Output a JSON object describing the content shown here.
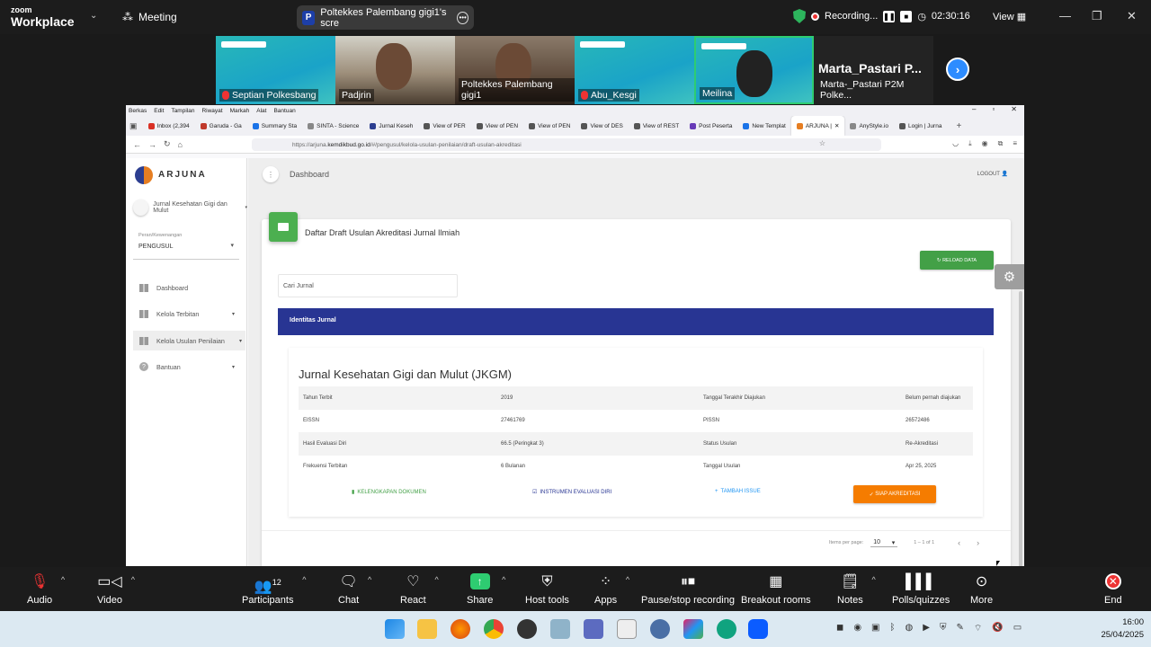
{
  "zoom": {
    "brand_small": "zoom",
    "brand": "Workplace",
    "meeting": "Meeting",
    "share_initial": "P",
    "share_title": "Poltekkes Palembang gigi1's scre",
    "recording": "Recording...",
    "timer": "02:30:16",
    "view": "View",
    "participants": [
      {
        "name": "Septian Polkesbang",
        "muted": true
      },
      {
        "name": "Padjrin",
        "muted": false
      },
      {
        "name": "Poltekkes Palembang gigi1",
        "muted": false
      },
      {
        "name": "Abu_Kesgi",
        "muted": true
      },
      {
        "name": "Meilina",
        "muted": false
      },
      {
        "name": "Marta-_Pastari P2M Polke...",
        "big": "Marta_Pastari P..."
      }
    ],
    "toolbar": {
      "audio": "Audio",
      "video": "Video",
      "participants": "Participants",
      "participants_count": "12",
      "chat": "Chat",
      "react": "React",
      "share": "Share",
      "host_tools": "Host tools",
      "apps": "Apps",
      "pause_rec": "Pause/stop recording",
      "breakout": "Breakout rooms",
      "notes": "Notes",
      "polls": "Polls/quizzes",
      "more": "More",
      "end": "End"
    }
  },
  "browser": {
    "menu": [
      "Berkas",
      "Edit",
      "Tampilan",
      "Riwayat",
      "Markah",
      "Alat",
      "Bantuan"
    ],
    "tabs": [
      {
        "label": "Inbox (2,394",
        "color": "#d93025"
      },
      {
        "label": "Garuda - Ga",
        "color": "#c0392b"
      },
      {
        "label": "Summary Sta",
        "color": "#1a73e8"
      },
      {
        "label": "SINTA - Science",
        "color": "#888"
      },
      {
        "label": "Jurnal Keseh",
        "color": "#2c3e90"
      },
      {
        "label": "View of PER",
        "color": "#555"
      },
      {
        "label": "View of PEN",
        "color": "#555"
      },
      {
        "label": "View of PEN",
        "color": "#555"
      },
      {
        "label": "View of DES",
        "color": "#555"
      },
      {
        "label": "View of REST",
        "color": "#555"
      },
      {
        "label": "Post Peserta",
        "color": "#673ab7"
      },
      {
        "label": "New Templat",
        "color": "#1a73e8"
      },
      {
        "label": "ARJUNA |",
        "color": "#e67e22",
        "active": true
      },
      {
        "label": "AnyStyle.io",
        "color": "#888"
      },
      {
        "label": "Login | Jurna",
        "color": "#555"
      }
    ],
    "url_prefix": "https://arjuna.",
    "url_domain": "kemdikbud.go.id",
    "url_path": "/#/pengusul/kelola-usulan-penilaian/draft-usulan-akreditasi"
  },
  "app": {
    "logo": "ARJUNA",
    "journal": "Jurnal Kesehatan Gigi dan Mulut",
    "role_label": "Peran/Kewenangan",
    "role_value": "PENGUSUL",
    "nav": [
      {
        "label": "Dashboard",
        "caret": ""
      },
      {
        "label": "Kelola Terbitan",
        "caret": "▾"
      },
      {
        "label": "Kelola Usulan Penilaian",
        "caret": "▾"
      },
      {
        "label": "Bantuan",
        "caret": "▾"
      }
    ],
    "breadcrumb": "Dashboard",
    "logout": "LOGOUT",
    "card_title": "Daftar Draft Usulan Akreditasi Jurnal Ilmiah",
    "reload": "RELOAD DATA",
    "search_placeholder": "Cari Jurnal",
    "section": "Identitas Jurnal",
    "journal_title": "Jurnal Kesehatan Gigi dan Mulut (JKGM)",
    "rows": [
      [
        "Tahun Terbit",
        "2019",
        "Tanggal Terakhir Diajukan",
        "Belum pernah diajukan"
      ],
      [
        "EISSN",
        "27461769",
        "PISSN",
        "26572486"
      ],
      [
        "Hasil Evaluasi Diri",
        "66.5 (Peringkat 3)",
        "Status Usulan",
        "Re-Akreditasi"
      ],
      [
        "Frekuensi Terbitan",
        "6 Bulanan",
        "Tanggal Usulan",
        "Apr 25, 2025"
      ]
    ],
    "actions": {
      "kelengkapan": "KELENGKAPAN DOKUMEN",
      "instrumen": "INSTRUMEN EVALUASI DIRI",
      "tambah": "TAMBAH ISSUE",
      "siap": "SIAP AKREDITASI"
    },
    "pager": {
      "label": "Items per page:",
      "per_page": "10",
      "range": "1 – 1 of 1"
    }
  },
  "taskbar": {
    "time": "16:00",
    "date": "25/04/2025"
  }
}
